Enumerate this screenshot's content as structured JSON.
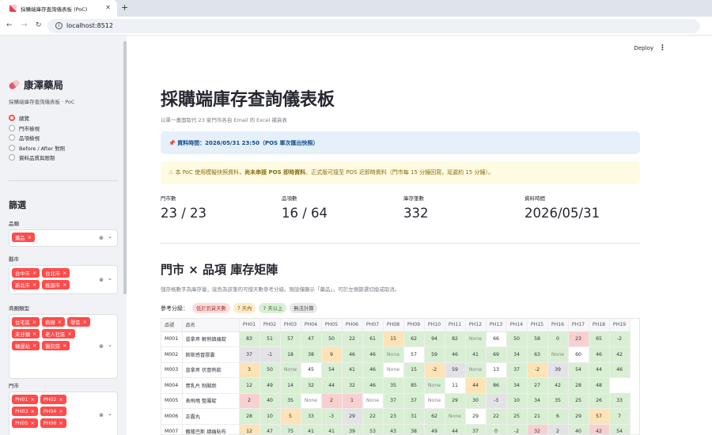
{
  "browser": {
    "tab_title": "採購端庫存查詢儀表板 (PoC)",
    "url": "localhost:8512"
  },
  "header": {
    "deploy": "Deploy"
  },
  "sidebar": {
    "brand": "康澤藥局",
    "subtitle": "採購端庫存查詢儀表板 · PoC",
    "nav": [
      "總覽",
      "門市檢視",
      "品項檢視",
      "Before / After 對照",
      "資料品質與限制"
    ],
    "nav_selected": 0,
    "filter_title": "篩選",
    "filters": [
      {
        "label": "品類",
        "chips": [
          "藥品"
        ]
      },
      {
        "label": "縣市",
        "chips": [
          "台中市",
          "台北市",
          "新北市",
          "桃園市"
        ]
      },
      {
        "label": "商圈類型",
        "chips": [
          "住宅區",
          "商辦",
          "學區",
          "未分類",
          "老人社區",
          "轉運站",
          "醫院旁"
        ]
      },
      {
        "label": "門市",
        "chips": [
          "PH01",
          "PH02",
          "PH03",
          "PH04",
          "PH05",
          "PH06"
        ]
      }
    ]
  },
  "main": {
    "title": "採購端庫存查詢儀表板",
    "caption": "以單一畫面取代 23 家門市各自 Email 的 Excel 補貨表",
    "info": "資料時間：2026/05/31 23:50（POS 單次匯出快照）",
    "warning_pre": "本 PoC 使用模擬快照資料，",
    "warning_bold": "尚未串接 POS 即時資料",
    "warning_post": "。正式版可接至 POS 近即時資料（門市每 15 分鐘回寫，延遲約 15 分鐘）。",
    "metrics": [
      {
        "label": "門市數",
        "value": "23 / 23"
      },
      {
        "label": "品項數",
        "value": "16 / 64"
      },
      {
        "label": "庫存筆數",
        "value": "332"
      },
      {
        "label": "資料時間",
        "value": "2026/05/31"
      }
    ],
    "matrix_title": "門市 × 品項 庫存矩陣",
    "matrix_caption": "儲存格數字為庫存量，底色為該筆的可撐天數參考分級。預設僅顯示「藥品」，可於左側篩選切換或取消。",
    "legend_label": "參考分級：",
    "legend": [
      {
        "label": "低於到貨天數",
        "bg": "#fddede",
        "fg": "#a33"
      },
      {
        "label": "7 天內",
        "bg": "#fdeccc",
        "fg": "#8a5a00"
      },
      {
        "label": "7 天以上",
        "bg": "#d9f0d6",
        "fg": "#2f6a2a"
      },
      {
        "label": "無法計算",
        "bg": "#e8e8ea",
        "fg": "#444"
      }
    ],
    "colors": {
      "red": "#f9d0d0",
      "orange": "#fde3b5",
      "green": "#d9efd3",
      "gray": "#e3e3e6",
      "white": "#ffffff"
    }
  },
  "table": {
    "columns": [
      "品號",
      "品名",
      "PH01",
      "PH02",
      "PH03",
      "PH04",
      "PH05",
      "PH06",
      "PH07",
      "PH08",
      "PH09",
      "PH10",
      "PH11",
      "PH12",
      "PH13",
      "PH14",
      "PH15",
      "PH16",
      "PH17",
      "PH18",
      "PH19"
    ],
    "rows": [
      {
        "id": "M001",
        "name": "普拿疼 解熱鎮痛錠",
        "v": [
          "83",
          "51",
          "57",
          "47",
          "50",
          "22",
          "61",
          "15",
          "62",
          "94",
          "82",
          "None",
          "66",
          "50",
          "58",
          "0",
          "23",
          "65",
          "-2"
        ],
        "c": "gggggggoggggwgggrggx"
      },
      {
        "id": "M002",
        "name": "斯斯感冒膠囊",
        "v": [
          "37",
          "-1",
          "18",
          "38",
          "9",
          "46",
          "46",
          "None",
          "57",
          "59",
          "46",
          "41",
          "69",
          "34",
          "63",
          "None",
          "60",
          "46",
          "42"
        ],
        "c": "xxggogggwgggggggwggg"
      },
      {
        "id": "M003",
        "name": "普拿疼 伏冒熱飲",
        "v": [
          "3",
          "50",
          "None",
          "45",
          "54",
          "41",
          "46",
          "None",
          "15",
          "-2",
          "59",
          "None",
          "13",
          "37",
          "-2",
          "39",
          "54",
          "44",
          "46"
        ],
        "c": "oggwgggwgoxgwgoxgggg"
      },
      {
        "id": "M004",
        "name": "胃乳片 制酸劑",
        "v": [
          "12",
          "49",
          "14",
          "32",
          "44",
          "32",
          "46",
          "35",
          "85",
          "None",
          "11",
          "44",
          "86",
          "34",
          "27",
          "42",
          "28",
          "48"
        ],
        "c": "ggggggggggwoggggggg"
      },
      {
        "id": "M005",
        "name": "表飛鳴 整腸錠",
        "v": [
          "2",
          "40",
          "35",
          "None",
          "2",
          "1",
          "None",
          "37",
          "37",
          "None",
          "29",
          "30",
          "-3",
          "10",
          "34",
          "35",
          "25",
          "26",
          "33"
        ],
        "c": "rggwrrwggwggxgggggg"
      },
      {
        "id": "M006",
        "name": "正露丸",
        "v": [
          "28",
          "10",
          "5",
          "33",
          "-3",
          "29",
          "22",
          "23",
          "31",
          "62",
          "None",
          "29",
          "22",
          "25",
          "21",
          "6",
          "29",
          "57",
          "7"
        ],
        "c": "ggoggxgggggwgggggogo"
      },
      {
        "id": "M007",
        "name": "撒隆巴斯 鎮痛貼布",
        "v": [
          "12",
          "47",
          "75",
          "41",
          "41",
          "39",
          "53",
          "43",
          "38",
          "49",
          "44",
          "37",
          "0",
          "-2",
          "32",
          "2",
          "40",
          "42",
          "54"
        ],
        "c": "ogggggggggggggrxgrggg"
      }
    ]
  }
}
